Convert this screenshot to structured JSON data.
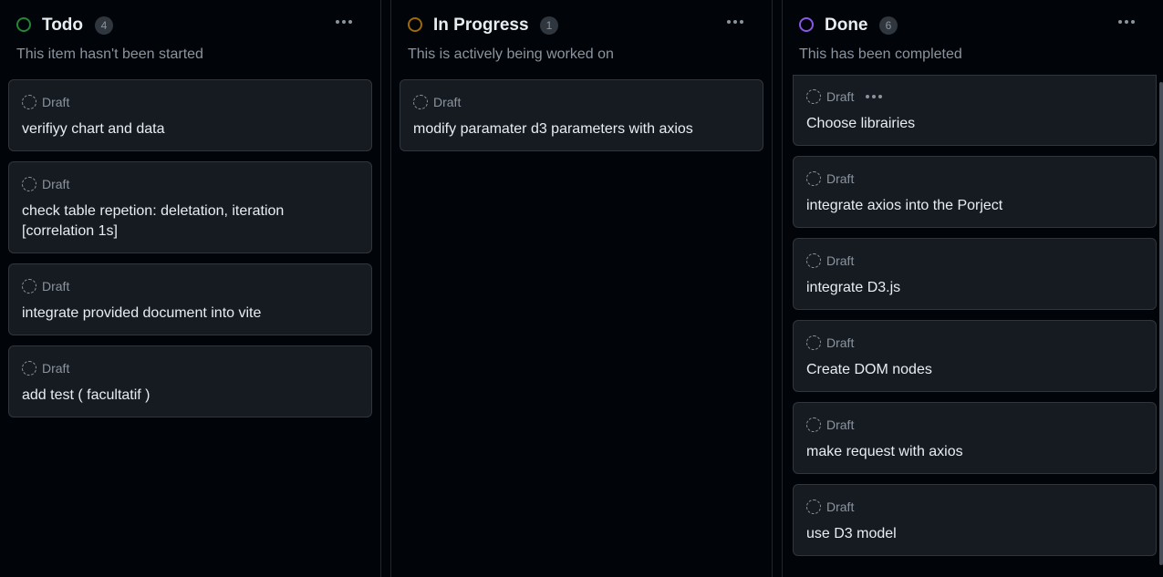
{
  "colors": {
    "todo": "#238636",
    "in_progress": "#9e6a03",
    "done": "#8957e5"
  },
  "columns": [
    {
      "title": "Todo",
      "count": "4",
      "description": "This item hasn't been started",
      "cards": [
        {
          "label": "Draft",
          "title": "verifiyy chart and data"
        },
        {
          "label": "Draft",
          "title": "check table repetion: deletation, iteration [correlation 1s]"
        },
        {
          "label": "Draft",
          "title": "integrate provided document into vite"
        },
        {
          "label": "Draft",
          "title": "add test ( facultatif )"
        }
      ]
    },
    {
      "title": "In Progress",
      "count": "1",
      "description": "This is actively being worked on",
      "cards": [
        {
          "label": "Draft",
          "title": "modify paramater d3 parameters with axios"
        }
      ]
    },
    {
      "title": "Done",
      "count": "6",
      "description": "This has been completed",
      "cards": [
        {
          "label": "Draft",
          "title": "Choose librairies"
        },
        {
          "label": "Draft",
          "title": "integrate axios into the Porject"
        },
        {
          "label": "Draft",
          "title": "integrate D3.js"
        },
        {
          "label": "Draft",
          "title": "Create DOM nodes"
        },
        {
          "label": "Draft",
          "title": "make request with axios"
        },
        {
          "label": "Draft",
          "title": "use D3 model"
        }
      ]
    }
  ]
}
